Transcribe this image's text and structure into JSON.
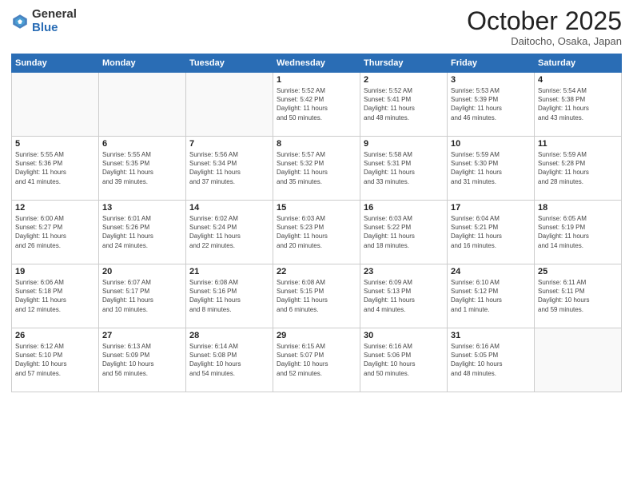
{
  "header": {
    "logo_general": "General",
    "logo_blue": "Blue",
    "month": "October 2025",
    "location": "Daitocho, Osaka, Japan"
  },
  "days_of_week": [
    "Sunday",
    "Monday",
    "Tuesday",
    "Wednesday",
    "Thursday",
    "Friday",
    "Saturday"
  ],
  "weeks": [
    [
      {
        "day": "",
        "info": ""
      },
      {
        "day": "",
        "info": ""
      },
      {
        "day": "",
        "info": ""
      },
      {
        "day": "1",
        "info": "Sunrise: 5:52 AM\nSunset: 5:42 PM\nDaylight: 11 hours\nand 50 minutes."
      },
      {
        "day": "2",
        "info": "Sunrise: 5:52 AM\nSunset: 5:41 PM\nDaylight: 11 hours\nand 48 minutes."
      },
      {
        "day": "3",
        "info": "Sunrise: 5:53 AM\nSunset: 5:39 PM\nDaylight: 11 hours\nand 46 minutes."
      },
      {
        "day": "4",
        "info": "Sunrise: 5:54 AM\nSunset: 5:38 PM\nDaylight: 11 hours\nand 43 minutes."
      }
    ],
    [
      {
        "day": "5",
        "info": "Sunrise: 5:55 AM\nSunset: 5:36 PM\nDaylight: 11 hours\nand 41 minutes."
      },
      {
        "day": "6",
        "info": "Sunrise: 5:55 AM\nSunset: 5:35 PM\nDaylight: 11 hours\nand 39 minutes."
      },
      {
        "day": "7",
        "info": "Sunrise: 5:56 AM\nSunset: 5:34 PM\nDaylight: 11 hours\nand 37 minutes."
      },
      {
        "day": "8",
        "info": "Sunrise: 5:57 AM\nSunset: 5:32 PM\nDaylight: 11 hours\nand 35 minutes."
      },
      {
        "day": "9",
        "info": "Sunrise: 5:58 AM\nSunset: 5:31 PM\nDaylight: 11 hours\nand 33 minutes."
      },
      {
        "day": "10",
        "info": "Sunrise: 5:59 AM\nSunset: 5:30 PM\nDaylight: 11 hours\nand 31 minutes."
      },
      {
        "day": "11",
        "info": "Sunrise: 5:59 AM\nSunset: 5:28 PM\nDaylight: 11 hours\nand 28 minutes."
      }
    ],
    [
      {
        "day": "12",
        "info": "Sunrise: 6:00 AM\nSunset: 5:27 PM\nDaylight: 11 hours\nand 26 minutes."
      },
      {
        "day": "13",
        "info": "Sunrise: 6:01 AM\nSunset: 5:26 PM\nDaylight: 11 hours\nand 24 minutes."
      },
      {
        "day": "14",
        "info": "Sunrise: 6:02 AM\nSunset: 5:24 PM\nDaylight: 11 hours\nand 22 minutes."
      },
      {
        "day": "15",
        "info": "Sunrise: 6:03 AM\nSunset: 5:23 PM\nDaylight: 11 hours\nand 20 minutes."
      },
      {
        "day": "16",
        "info": "Sunrise: 6:03 AM\nSunset: 5:22 PM\nDaylight: 11 hours\nand 18 minutes."
      },
      {
        "day": "17",
        "info": "Sunrise: 6:04 AM\nSunset: 5:21 PM\nDaylight: 11 hours\nand 16 minutes."
      },
      {
        "day": "18",
        "info": "Sunrise: 6:05 AM\nSunset: 5:19 PM\nDaylight: 11 hours\nand 14 minutes."
      }
    ],
    [
      {
        "day": "19",
        "info": "Sunrise: 6:06 AM\nSunset: 5:18 PM\nDaylight: 11 hours\nand 12 minutes."
      },
      {
        "day": "20",
        "info": "Sunrise: 6:07 AM\nSunset: 5:17 PM\nDaylight: 11 hours\nand 10 minutes."
      },
      {
        "day": "21",
        "info": "Sunrise: 6:08 AM\nSunset: 5:16 PM\nDaylight: 11 hours\nand 8 minutes."
      },
      {
        "day": "22",
        "info": "Sunrise: 6:08 AM\nSunset: 5:15 PM\nDaylight: 11 hours\nand 6 minutes."
      },
      {
        "day": "23",
        "info": "Sunrise: 6:09 AM\nSunset: 5:13 PM\nDaylight: 11 hours\nand 4 minutes."
      },
      {
        "day": "24",
        "info": "Sunrise: 6:10 AM\nSunset: 5:12 PM\nDaylight: 11 hours\nand 1 minute."
      },
      {
        "day": "25",
        "info": "Sunrise: 6:11 AM\nSunset: 5:11 PM\nDaylight: 10 hours\nand 59 minutes."
      }
    ],
    [
      {
        "day": "26",
        "info": "Sunrise: 6:12 AM\nSunset: 5:10 PM\nDaylight: 10 hours\nand 57 minutes."
      },
      {
        "day": "27",
        "info": "Sunrise: 6:13 AM\nSunset: 5:09 PM\nDaylight: 10 hours\nand 56 minutes."
      },
      {
        "day": "28",
        "info": "Sunrise: 6:14 AM\nSunset: 5:08 PM\nDaylight: 10 hours\nand 54 minutes."
      },
      {
        "day": "29",
        "info": "Sunrise: 6:15 AM\nSunset: 5:07 PM\nDaylight: 10 hours\nand 52 minutes."
      },
      {
        "day": "30",
        "info": "Sunrise: 6:16 AM\nSunset: 5:06 PM\nDaylight: 10 hours\nand 50 minutes."
      },
      {
        "day": "31",
        "info": "Sunrise: 6:16 AM\nSunset: 5:05 PM\nDaylight: 10 hours\nand 48 minutes."
      },
      {
        "day": "",
        "info": ""
      }
    ]
  ]
}
